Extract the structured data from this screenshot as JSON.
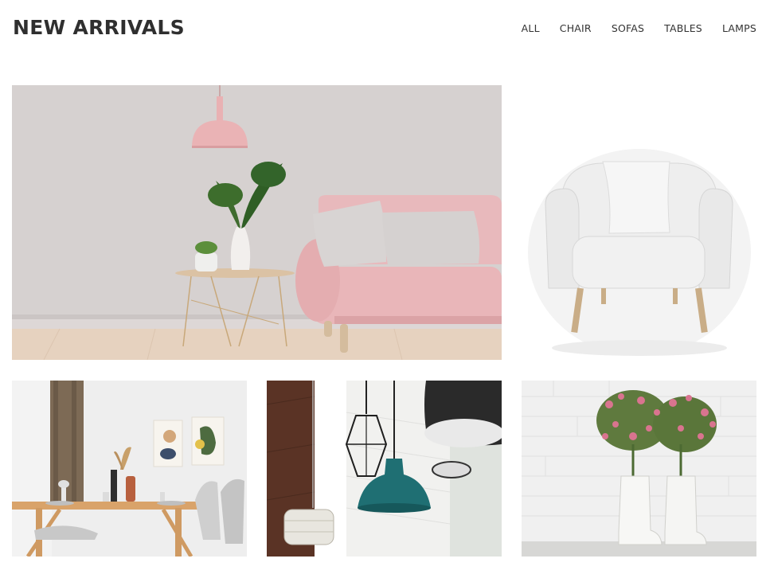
{
  "header": {
    "title": "NEW ARRIVALS"
  },
  "filters": [
    {
      "label": "ALL"
    },
    {
      "label": "CHAIR"
    },
    {
      "label": "SOFAS"
    },
    {
      "label": "TABLES"
    },
    {
      "label": "LAMPS"
    }
  ],
  "gallery": {
    "items": [
      {
        "subject": "pink-sofa-living-room"
      },
      {
        "subject": "white-armchair"
      },
      {
        "subject": "dining-table"
      },
      {
        "subject": "pendant-lamps"
      },
      {
        "subject": "flowers-in-boots"
      }
    ]
  },
  "colors": {
    "title": "#2f2f2f",
    "nav_text": "#333333",
    "sofa_pink": "#e8b9bc",
    "lamp_teal": "#1f6f73"
  }
}
